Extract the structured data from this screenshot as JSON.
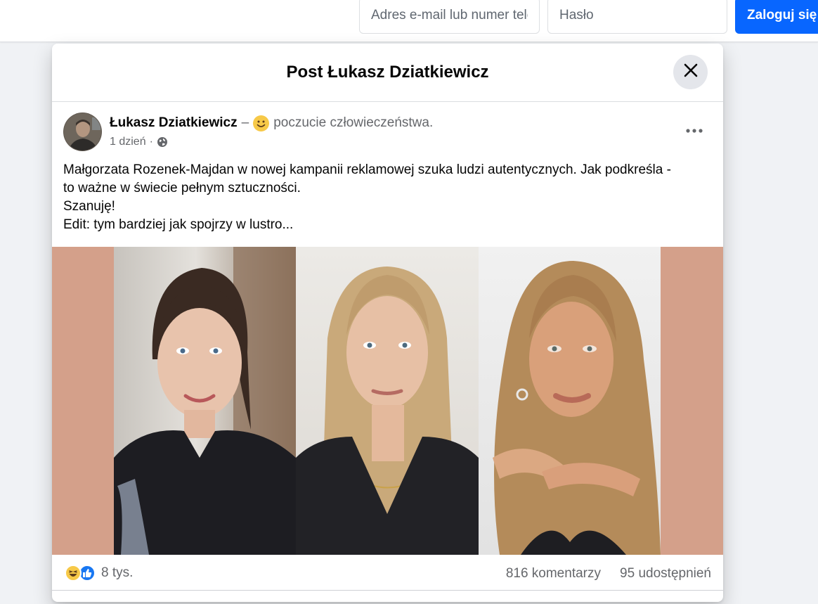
{
  "login": {
    "email_placeholder": "Adres e-mail lub numer telefonu",
    "password_placeholder": "Hasło",
    "login_button": "Zaloguj się"
  },
  "dialog": {
    "title": "Post Łukasz Dziatkiewicz",
    "close_icon": "close-icon"
  },
  "post": {
    "author": "Łukasz Dziatkiewicz",
    "separator": "–",
    "feeling_icon": "slightly-smiling-face-emoji",
    "feeling": "poczucie człowieczeństwa.",
    "timestamp": "1 dzień",
    "meta_dot": "·",
    "audience_icon": "globe-icon",
    "more_icon": "more-horizontal-icon",
    "text_lines": [
      "Małgorzata Rozenek-Majdan w nowej kampanii reklamowej szuka ludzi autentycznych. Jak podkreśla -",
      "to ważne w świecie pełnym sztuczności.",
      "Szanuję!",
      "Edit: tym bardziej jak spojrzy w lustro..."
    ],
    "image_background_color": "#d4a08a"
  },
  "stats": {
    "reaction_icons": [
      "haha-icon",
      "like-icon"
    ],
    "reactions_count": "8 tys.",
    "comments": "816 komentarzy",
    "shares": "95 udostępnień"
  },
  "colors": {
    "accent": "#0866ff",
    "secondary_text": "#65676b",
    "page_background": "#f0f2f5"
  }
}
